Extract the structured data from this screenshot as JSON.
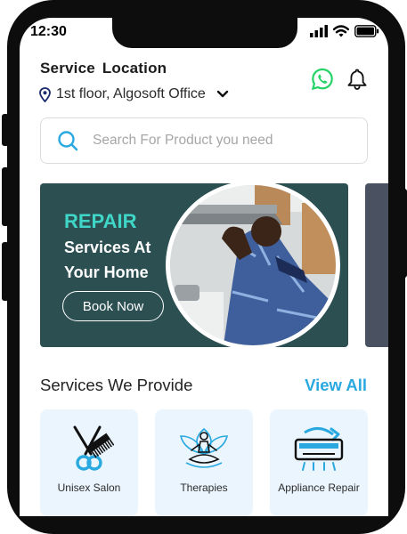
{
  "status_bar": {
    "time": "12:30"
  },
  "header": {
    "location_title": "Service  Location",
    "location_value": "1st floor, Algosoft Office"
  },
  "search": {
    "placeholder": "Search For Product you need"
  },
  "banner": {
    "title": "REPAIR",
    "subtitle_line1": "Services At",
    "subtitle_line2": "Your Home",
    "button_label": "Book Now"
  },
  "services": {
    "title": "Services We Provide",
    "view_all": "View All",
    "items": [
      {
        "label": "Unisex Salon",
        "icon": "scissors-comb-icon"
      },
      {
        "label": "Therapies",
        "icon": "meditation-lotus-icon"
      },
      {
        "label": "Appliance Repair",
        "icon": "air-conditioner-wrench-icon"
      }
    ]
  },
  "colors": {
    "accent": "#2aa9e0",
    "banner_bg": "#2c4f52",
    "banner_title": "#3fd6c8",
    "whatsapp": "#25d366",
    "card_bg": "#eaf5fd"
  }
}
